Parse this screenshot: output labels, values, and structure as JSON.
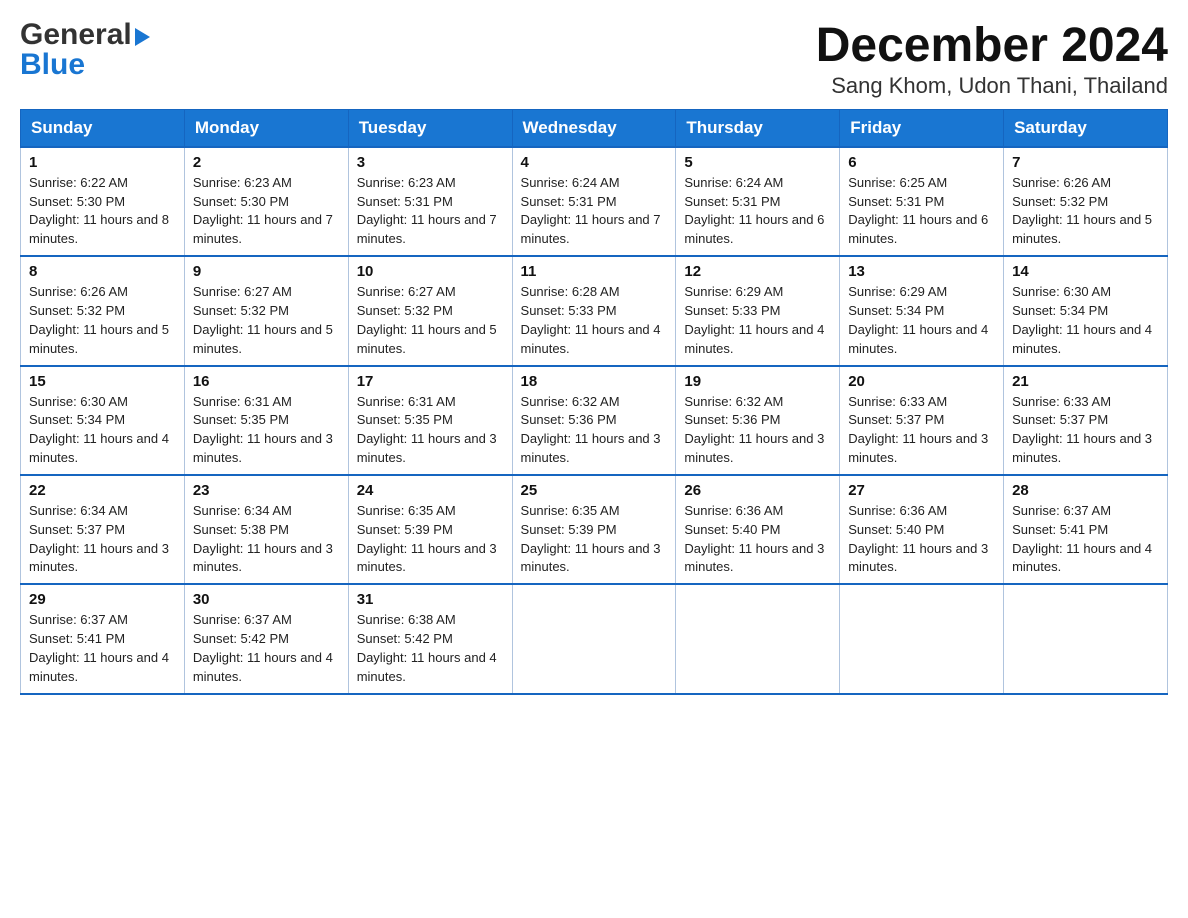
{
  "header": {
    "month_title": "December 2024",
    "location": "Sang Khom, Udon Thani, Thailand",
    "logo_top": "General",
    "logo_bottom": "Blue"
  },
  "days_of_week": [
    "Sunday",
    "Monday",
    "Tuesday",
    "Wednesday",
    "Thursday",
    "Friday",
    "Saturday"
  ],
  "weeks": [
    [
      {
        "day": "1",
        "sunrise": "6:22 AM",
        "sunset": "5:30 PM",
        "daylight": "11 hours and 8 minutes."
      },
      {
        "day": "2",
        "sunrise": "6:23 AM",
        "sunset": "5:30 PM",
        "daylight": "11 hours and 7 minutes."
      },
      {
        "day": "3",
        "sunrise": "6:23 AM",
        "sunset": "5:31 PM",
        "daylight": "11 hours and 7 minutes."
      },
      {
        "day": "4",
        "sunrise": "6:24 AM",
        "sunset": "5:31 PM",
        "daylight": "11 hours and 7 minutes."
      },
      {
        "day": "5",
        "sunrise": "6:24 AM",
        "sunset": "5:31 PM",
        "daylight": "11 hours and 6 minutes."
      },
      {
        "day": "6",
        "sunrise": "6:25 AM",
        "sunset": "5:31 PM",
        "daylight": "11 hours and 6 minutes."
      },
      {
        "day": "7",
        "sunrise": "6:26 AM",
        "sunset": "5:32 PM",
        "daylight": "11 hours and 5 minutes."
      }
    ],
    [
      {
        "day": "8",
        "sunrise": "6:26 AM",
        "sunset": "5:32 PM",
        "daylight": "11 hours and 5 minutes."
      },
      {
        "day": "9",
        "sunrise": "6:27 AM",
        "sunset": "5:32 PM",
        "daylight": "11 hours and 5 minutes."
      },
      {
        "day": "10",
        "sunrise": "6:27 AM",
        "sunset": "5:32 PM",
        "daylight": "11 hours and 5 minutes."
      },
      {
        "day": "11",
        "sunrise": "6:28 AM",
        "sunset": "5:33 PM",
        "daylight": "11 hours and 4 minutes."
      },
      {
        "day": "12",
        "sunrise": "6:29 AM",
        "sunset": "5:33 PM",
        "daylight": "11 hours and 4 minutes."
      },
      {
        "day": "13",
        "sunrise": "6:29 AM",
        "sunset": "5:34 PM",
        "daylight": "11 hours and 4 minutes."
      },
      {
        "day": "14",
        "sunrise": "6:30 AM",
        "sunset": "5:34 PM",
        "daylight": "11 hours and 4 minutes."
      }
    ],
    [
      {
        "day": "15",
        "sunrise": "6:30 AM",
        "sunset": "5:34 PM",
        "daylight": "11 hours and 4 minutes."
      },
      {
        "day": "16",
        "sunrise": "6:31 AM",
        "sunset": "5:35 PM",
        "daylight": "11 hours and 3 minutes."
      },
      {
        "day": "17",
        "sunrise": "6:31 AM",
        "sunset": "5:35 PM",
        "daylight": "11 hours and 3 minutes."
      },
      {
        "day": "18",
        "sunrise": "6:32 AM",
        "sunset": "5:36 PM",
        "daylight": "11 hours and 3 minutes."
      },
      {
        "day": "19",
        "sunrise": "6:32 AM",
        "sunset": "5:36 PM",
        "daylight": "11 hours and 3 minutes."
      },
      {
        "day": "20",
        "sunrise": "6:33 AM",
        "sunset": "5:37 PM",
        "daylight": "11 hours and 3 minutes."
      },
      {
        "day": "21",
        "sunrise": "6:33 AM",
        "sunset": "5:37 PM",
        "daylight": "11 hours and 3 minutes."
      }
    ],
    [
      {
        "day": "22",
        "sunrise": "6:34 AM",
        "sunset": "5:37 PM",
        "daylight": "11 hours and 3 minutes."
      },
      {
        "day": "23",
        "sunrise": "6:34 AM",
        "sunset": "5:38 PM",
        "daylight": "11 hours and 3 minutes."
      },
      {
        "day": "24",
        "sunrise": "6:35 AM",
        "sunset": "5:39 PM",
        "daylight": "11 hours and 3 minutes."
      },
      {
        "day": "25",
        "sunrise": "6:35 AM",
        "sunset": "5:39 PM",
        "daylight": "11 hours and 3 minutes."
      },
      {
        "day": "26",
        "sunrise": "6:36 AM",
        "sunset": "5:40 PM",
        "daylight": "11 hours and 3 minutes."
      },
      {
        "day": "27",
        "sunrise": "6:36 AM",
        "sunset": "5:40 PM",
        "daylight": "11 hours and 3 minutes."
      },
      {
        "day": "28",
        "sunrise": "6:37 AM",
        "sunset": "5:41 PM",
        "daylight": "11 hours and 4 minutes."
      }
    ],
    [
      {
        "day": "29",
        "sunrise": "6:37 AM",
        "sunset": "5:41 PM",
        "daylight": "11 hours and 4 minutes."
      },
      {
        "day": "30",
        "sunrise": "6:37 AM",
        "sunset": "5:42 PM",
        "daylight": "11 hours and 4 minutes."
      },
      {
        "day": "31",
        "sunrise": "6:38 AM",
        "sunset": "5:42 PM",
        "daylight": "11 hours and 4 minutes."
      },
      null,
      null,
      null,
      null
    ]
  ],
  "labels": {
    "sunrise": "Sunrise:",
    "sunset": "Sunset:",
    "daylight": "Daylight:"
  }
}
